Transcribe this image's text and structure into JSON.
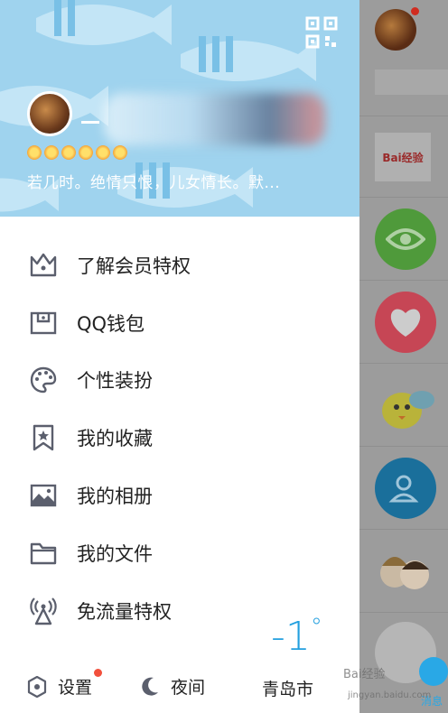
{
  "profile": {
    "signature": "若几时。绝情只恨，儿女情长。默...",
    "level_icons": [
      "sun-icon",
      "sun-icon",
      "sun-icon",
      "crown-sun-icon",
      "sun-icon",
      "sun-icon"
    ]
  },
  "menu": {
    "items": [
      {
        "label": "了解会员特权",
        "icon": "crown-icon"
      },
      {
        "label": "QQ钱包",
        "icon": "wallet-icon"
      },
      {
        "label": "个性装扮",
        "icon": "palette-icon"
      },
      {
        "label": "我的收藏",
        "icon": "bookmark-star-icon"
      },
      {
        "label": "我的相册",
        "icon": "photo-icon"
      },
      {
        "label": "我的文件",
        "icon": "folder-icon"
      },
      {
        "label": "免流量特权",
        "icon": "antenna-icon"
      }
    ]
  },
  "weather": {
    "temp": "-1",
    "unit": "°",
    "city": "青岛市"
  },
  "footer": {
    "settings_label": "设置",
    "night_label": "夜间"
  },
  "sidebar_strip": {
    "baidu_label": "Bai经验",
    "messages_label": "消息"
  },
  "watermark": {
    "line1": "Bai经验",
    "line2": "jingyan.baidu.com"
  },
  "colors": {
    "accent": "#24a0df",
    "header_bg": "#9fd3ee",
    "badge": "#f2503c"
  }
}
